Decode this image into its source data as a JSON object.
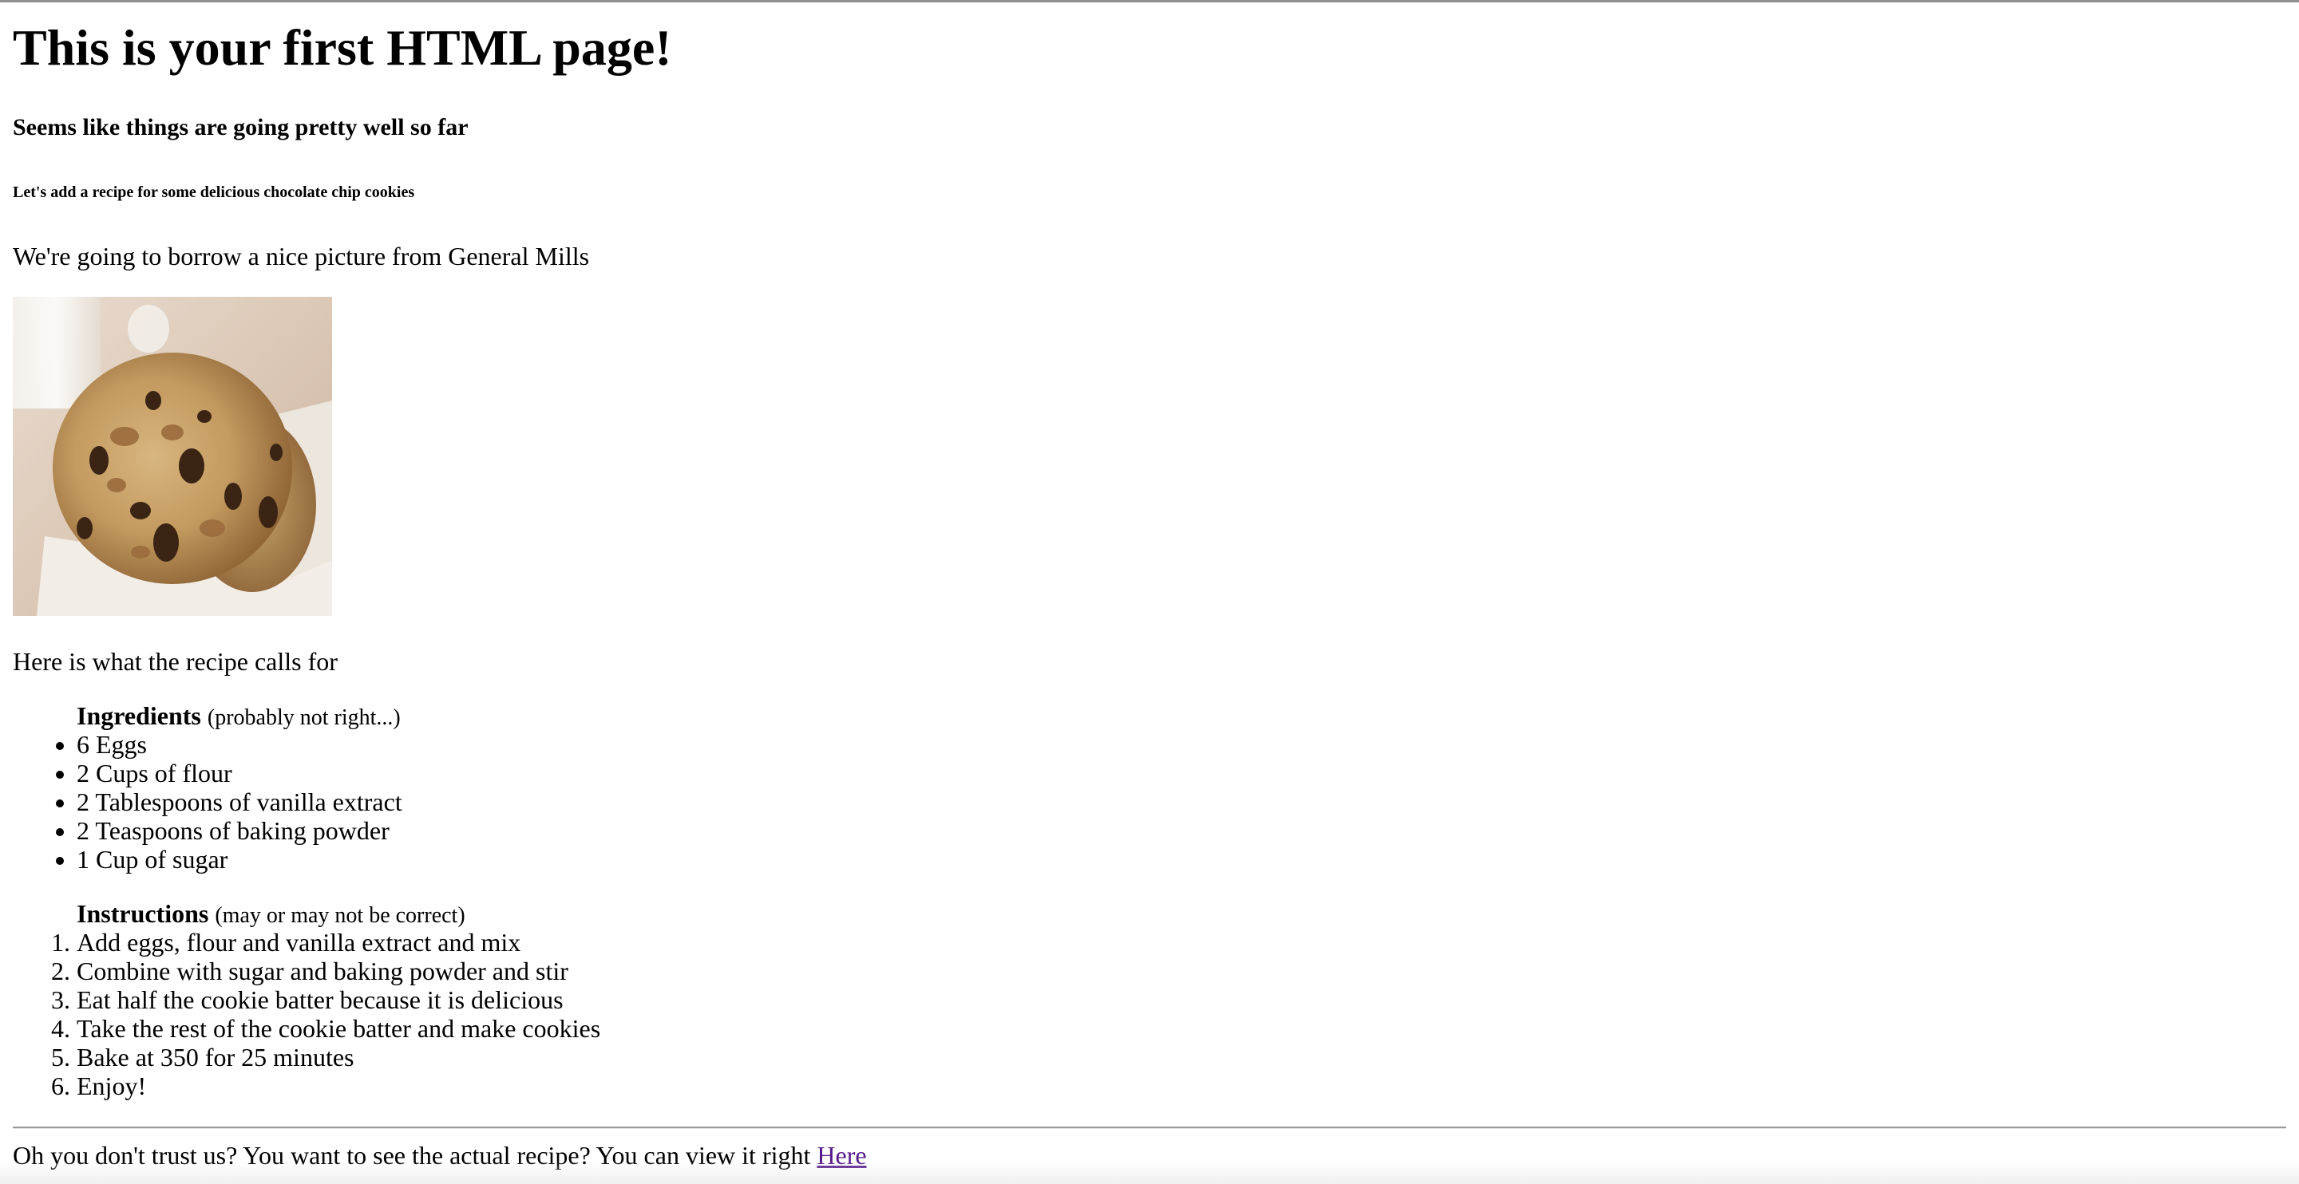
{
  "page": {
    "heading": "This is your first HTML page!",
    "subheading": "Seems like things are going pretty well so far",
    "small_heading": "Let's add a recipe for some delicious chocolate chip cookies",
    "borrow_text": "We're going to borrow a nice picture from General Mills",
    "calls_for_text": "Here is what the recipe calls for"
  },
  "ingredients": {
    "title": "Ingredients",
    "note": "(probably not right...)",
    "items": [
      "6 Eggs",
      "2 Cups of flour",
      "2 Tablespoons of vanilla extract",
      "2 Teaspoons of baking powder",
      "1 Cup of sugar"
    ]
  },
  "instructions": {
    "title": "Instructions",
    "note": "(may or may not be correct)",
    "steps": [
      "Add eggs, flour and vanilla extract and mix",
      "Combine with sugar and baking powder and stir",
      "Eat half the cookie batter because it is delicious",
      "Take the rest of the cookie batter and make cookies",
      "Bake at 350 for 25 minutes",
      "Enjoy!"
    ]
  },
  "footer": {
    "text": "Oh you don't trust us? You want to see the actual recipe? You can view it right",
    "link_label": "Here"
  },
  "colors": {
    "link_visited": "#551a8b",
    "rule": "#9a9a9a"
  }
}
